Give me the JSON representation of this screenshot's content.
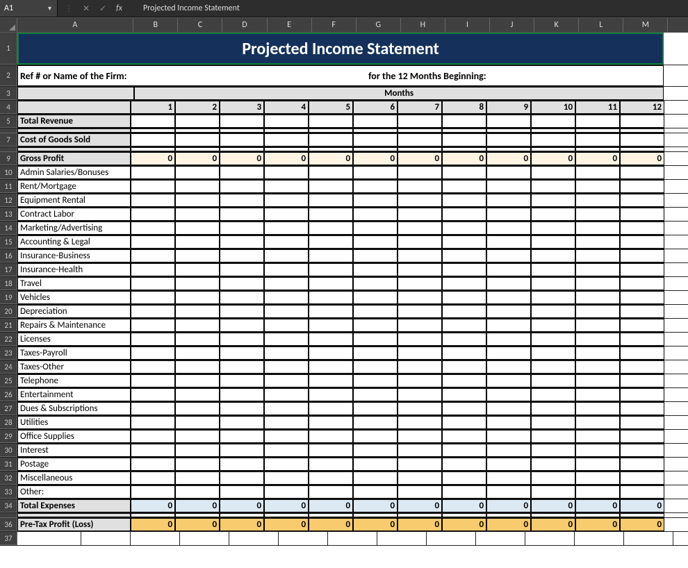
{
  "nameBox": "A1",
  "formulaBar": "Projected Income Statement",
  "columns": [
    "A",
    "B",
    "C",
    "D",
    "E",
    "F",
    "G",
    "H",
    "I",
    "J",
    "K",
    "L",
    "M"
  ],
  "banner": "Projected Income Statement",
  "subheader": {
    "left": "Ref # or Name of the Firm:",
    "right": "for the 12 Months Beginning:"
  },
  "monthsLabel": "Months",
  "monthNumbers": [
    "1",
    "2",
    "3",
    "4",
    "5",
    "6",
    "7",
    "8",
    "9",
    "10",
    "11",
    "12"
  ],
  "rows": {
    "totalRevenue": {
      "label": "Total Revenue"
    },
    "cogs": {
      "label": "Cost of Goods Sold"
    },
    "grossProfit": {
      "label": "Gross Profit",
      "vals": [
        "0",
        "0",
        "0",
        "0",
        "0",
        "0",
        "0",
        "0",
        "0",
        "0",
        "0",
        "0"
      ]
    },
    "expenses": [
      "Admin Salaries/Bonuses",
      "Rent/Mortgage",
      "Equipment Rental",
      "Contract Labor",
      "Marketing/Advertising",
      "Accounting & Legal",
      "Insurance-Business",
      "Insurance-Health",
      "Travel",
      "Vehicles",
      "Depreciation",
      "Repairs & Maintenance",
      "Licenses",
      "Taxes-Payroll",
      "Taxes-Other",
      "Telephone",
      "Entertainment",
      "Dues & Subscriptions",
      "Utilities",
      "Office Supplies",
      "Interest",
      "Postage",
      "Miscellaneous",
      "Other:"
    ],
    "totalExpenses": {
      "label": "Total Expenses",
      "vals": [
        "0",
        "0",
        "0",
        "0",
        "0",
        "0",
        "0",
        "0",
        "0",
        "0",
        "0",
        "0"
      ]
    },
    "preTax": {
      "label": "Pre-Tax Profit (Loss)",
      "vals": [
        "0",
        "0",
        "0",
        "0",
        "0",
        "0",
        "0",
        "0",
        "0",
        "0",
        "0",
        "0"
      ]
    }
  }
}
